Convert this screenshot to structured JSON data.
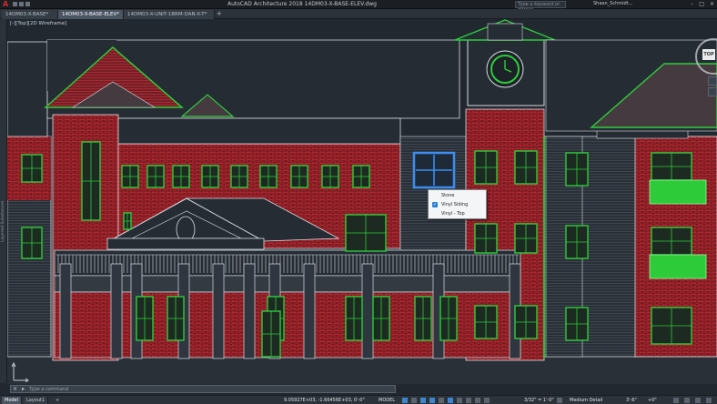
{
  "app": {
    "window_title": "AutoCAD Architecture 2018   14DM03-X-BASE-ELEV.dwg",
    "search_placeholder": "Type a keyword or phrase",
    "user_name": "Shaan_Schmidt...",
    "logo_glyph": "A"
  },
  "file_tabs": [
    {
      "label": "14DM03-X-BASE*",
      "active": false
    },
    {
      "label": "14DM03-X-BASE-ELEV*",
      "active": true
    },
    {
      "label": "14DM03-X-UNIT-1BRM-DAN-X-T*",
      "active": false
    }
  ],
  "viewport": {
    "label": "[-][Top][2D Wireframe]"
  },
  "left_palette": {
    "label": "Layered Substances"
  },
  "viewcube": {
    "face": "TOP"
  },
  "context_menu": {
    "items": [
      {
        "label": "Stone",
        "checked": false
      },
      {
        "label": "Vinyl Siding",
        "checked": true
      },
      {
        "label": "Vinyl - Top",
        "checked": false
      }
    ]
  },
  "command_line": {
    "placeholder": "Type a command"
  },
  "status_bar": {
    "layout_tabs": [
      {
        "label": "Model",
        "active": true
      },
      {
        "label": "Layout1",
        "active": false
      }
    ],
    "coordinates": "9.05927E+03, -1.66456E+03, 0'-0\"",
    "mode": "MODEL",
    "scale": "3/32\" = 1'-0\"",
    "detail": "Medium Detail",
    "elevation": "3'-6\"",
    "cut": "+0\""
  },
  "colors": {
    "background": "#212830",
    "brick": "#b3262f",
    "window_green": "#2dcb3a",
    "linework": "#d8dde2",
    "selection_blue": "#3c8df0"
  }
}
